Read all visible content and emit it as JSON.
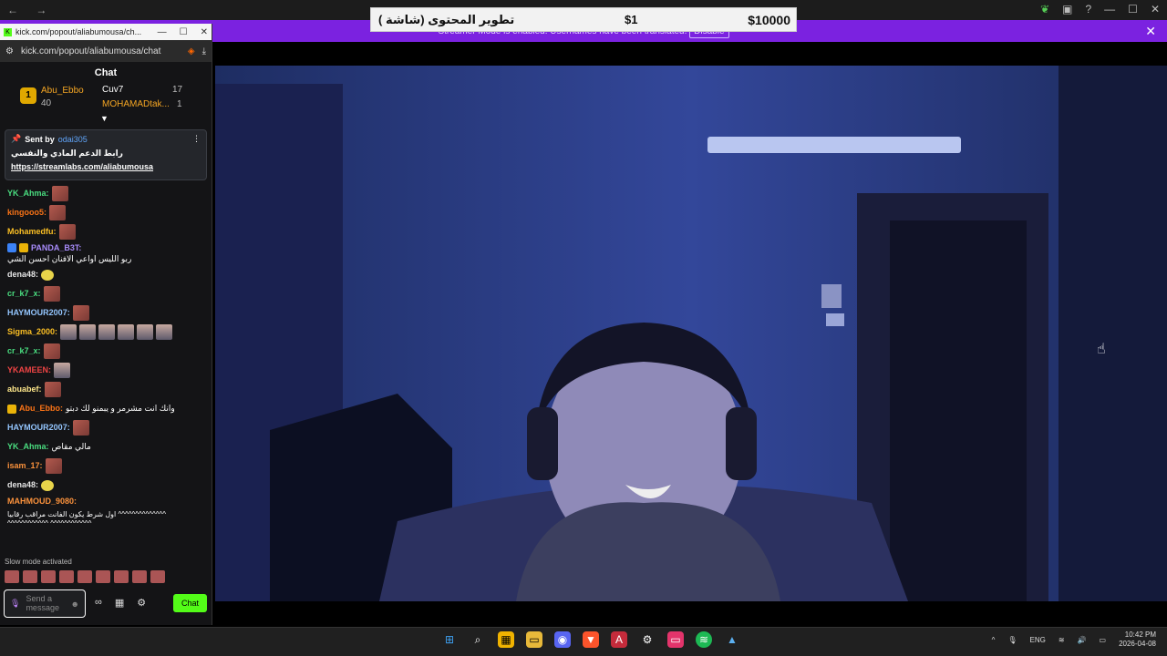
{
  "goal": {
    "amount_goal": "$10000",
    "amount_now": "$1",
    "title": "تطوير المحتوى (شاشة )"
  },
  "banner": {
    "text": "Streamer Mode is enabled. Usernames have been translated.",
    "disable": "Disable"
  },
  "window": {
    "title": "kick.com/popout/aliabumousa/ch...",
    "url": "kick.com/popout/aliabumousa/chat"
  },
  "chat": {
    "header": "Chat",
    "gifters": [
      {
        "rank": "1",
        "name": "Abu_Ebbo",
        "count": "40"
      },
      {
        "name": "Cuv7",
        "count": "17"
      },
      {
        "name": "MOHAMADtak...",
        "count": "1"
      }
    ],
    "pinned": {
      "sent_by": "Sent by",
      "user": "odai305",
      "line1": "رابط الدعم المادي والنفسي",
      "link": "https://streamlabs.com/aliabumousa"
    },
    "messages": [
      {
        "user": "YK_Ahma:",
        "color": "#4ade80",
        "text": ""
      },
      {
        "user": "kingooo5:",
        "color": "#f97316",
        "text": ""
      },
      {
        "user": "Mohamedfu:",
        "color": "#fbbf24",
        "text": ""
      },
      {
        "user": "PANDA_B3T:",
        "color": "#a78bfa",
        "text": "ربو الليس اواعي الافنان احسن الشي"
      },
      {
        "user": "dena48:",
        "color": "#e5e5e5",
        "text": ""
      },
      {
        "user": "cr_k7_x:",
        "color": "#4ade80",
        "text": ""
      },
      {
        "user": "HAYMOUR2007:",
        "color": "#93c5fd",
        "text": ""
      },
      {
        "user": "Sigma_2000:",
        "color": "#fbbf24",
        "text": ""
      },
      {
        "user": "cr_k7_x:",
        "color": "#4ade80",
        "text": ""
      },
      {
        "user": "YKAMEEN:",
        "color": "#ef4444",
        "text": ""
      },
      {
        "user": "abuabef:",
        "color": "#fde68a",
        "text": ""
      },
      {
        "user": "Abu_Ebbo:",
        "color": "#f97316",
        "text": "وانك انت مشرمر و يبمنو لك دبتو"
      },
      {
        "user": "HAYMOUR2007:",
        "color": "#93c5fd",
        "text": ""
      },
      {
        "user": "YK_Ahma:",
        "color": "#4ade80",
        "text": "مالي مقاص"
      },
      {
        "user": "isam_17:",
        "color": "#fb923c",
        "text": ""
      },
      {
        "user": "dena48:",
        "color": "#e5e5e5",
        "text": ""
      },
      {
        "user": "MAHMOUD_9080:",
        "color": "#fb923c",
        "text": "اول شرط يكون الفانت مراقب رقابيا ^^^^^^^^^^^^^^ ^^^^^^^^^^^^ ^^^^^^^^^^^^"
      }
    ],
    "slow_mode": "Slow mode activated",
    "placeholder": "Send a message",
    "send": "Chat"
  },
  "tray": {
    "lang": "ENG",
    "time": "10:42 PM",
    "date": "2026-04-08"
  }
}
